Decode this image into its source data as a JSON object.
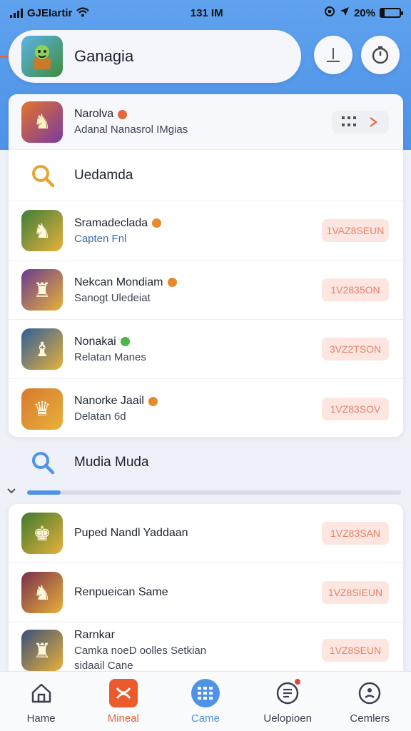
{
  "status_bar": {
    "carrier": "GJEIartir",
    "time": "131 IM",
    "battery": "20%",
    "battery_level": 0.2
  },
  "header": {
    "title": "Ganagia",
    "app_icon": "game-hero-icon"
  },
  "featured": {
    "title": "Narolva",
    "subtitle": "Adanal Nanasrol IMgias",
    "grid_icon": "grid-icon",
    "chevron_icon": "chevron-right-icon"
  },
  "section_one": {
    "title": "Uedamda",
    "icon": "search-icon",
    "items": [
      {
        "title": "Sramadeclada",
        "subtitle": "Capten Fnl",
        "button": "1VAZ8SEUN",
        "badge_color": "#e9892b",
        "sub_blue": true,
        "tile_bg": "#3d7e3a",
        "glyph": "♞"
      },
      {
        "title": "Nekcan Mondiam",
        "subtitle": "Sanogt Uledeiat",
        "button": "1V2835ON",
        "badge_color": "#e9892b",
        "sub_blue": false,
        "tile_bg": "#6a3a8e",
        "glyph": "♜"
      },
      {
        "title": "Nonakai",
        "subtitle": "Relatan Manes",
        "button": "3VZ2TSON",
        "badge_color": "#4bb54b",
        "sub_blue": false,
        "tile_bg": "#2c5e9a",
        "glyph": "♝"
      },
      {
        "title": "Nanorke Jaail",
        "subtitle": "Delatan 6d",
        "button": "1VZ83SOV",
        "badge_color": "#e9892b",
        "sub_blue": false,
        "tile_bg": "#d7782e",
        "glyph": "♛"
      }
    ]
  },
  "section_two": {
    "title": "Mudia Muda",
    "icon": "search-icon",
    "progress": 0.09,
    "items": [
      {
        "title": "Puped Nandl Yaddaan",
        "subtitle": "",
        "subtitle2": "",
        "button": "1VZ83SAN",
        "tile_bg": "#3f7a2e",
        "glyph": "♚"
      },
      {
        "title": "Renpueican Same",
        "subtitle": "",
        "subtitle2": "",
        "button": "1VZ8SIEUN",
        "tile_bg": "#7a2e4a",
        "glyph": "♞"
      },
      {
        "title": "Rarnkar",
        "subtitle": "Camka noeD oolles Setkian",
        "subtitle2": "sidaail Cane",
        "button": "1VZ8SEUN",
        "tile_bg": "#3a4f7a",
        "glyph": "♜"
      }
    ]
  },
  "tabbar": {
    "tabs": [
      {
        "label": "Hame",
        "icon": "home-icon",
        "color": "default"
      },
      {
        "label": "Mineal",
        "icon": "game-x-icon",
        "color": "orange"
      },
      {
        "label": "Came",
        "icon": "grid-apps-icon",
        "color": "blue"
      },
      {
        "label": "Uelopioen",
        "icon": "updates-icon",
        "color": "default"
      },
      {
        "label": "Cemlers",
        "icon": "profile-icon",
        "color": "default"
      }
    ]
  },
  "colors": {
    "accent_blue": "#4f93e9",
    "accent_orange": "#e8633a",
    "button_bg": "#fde6e0"
  }
}
